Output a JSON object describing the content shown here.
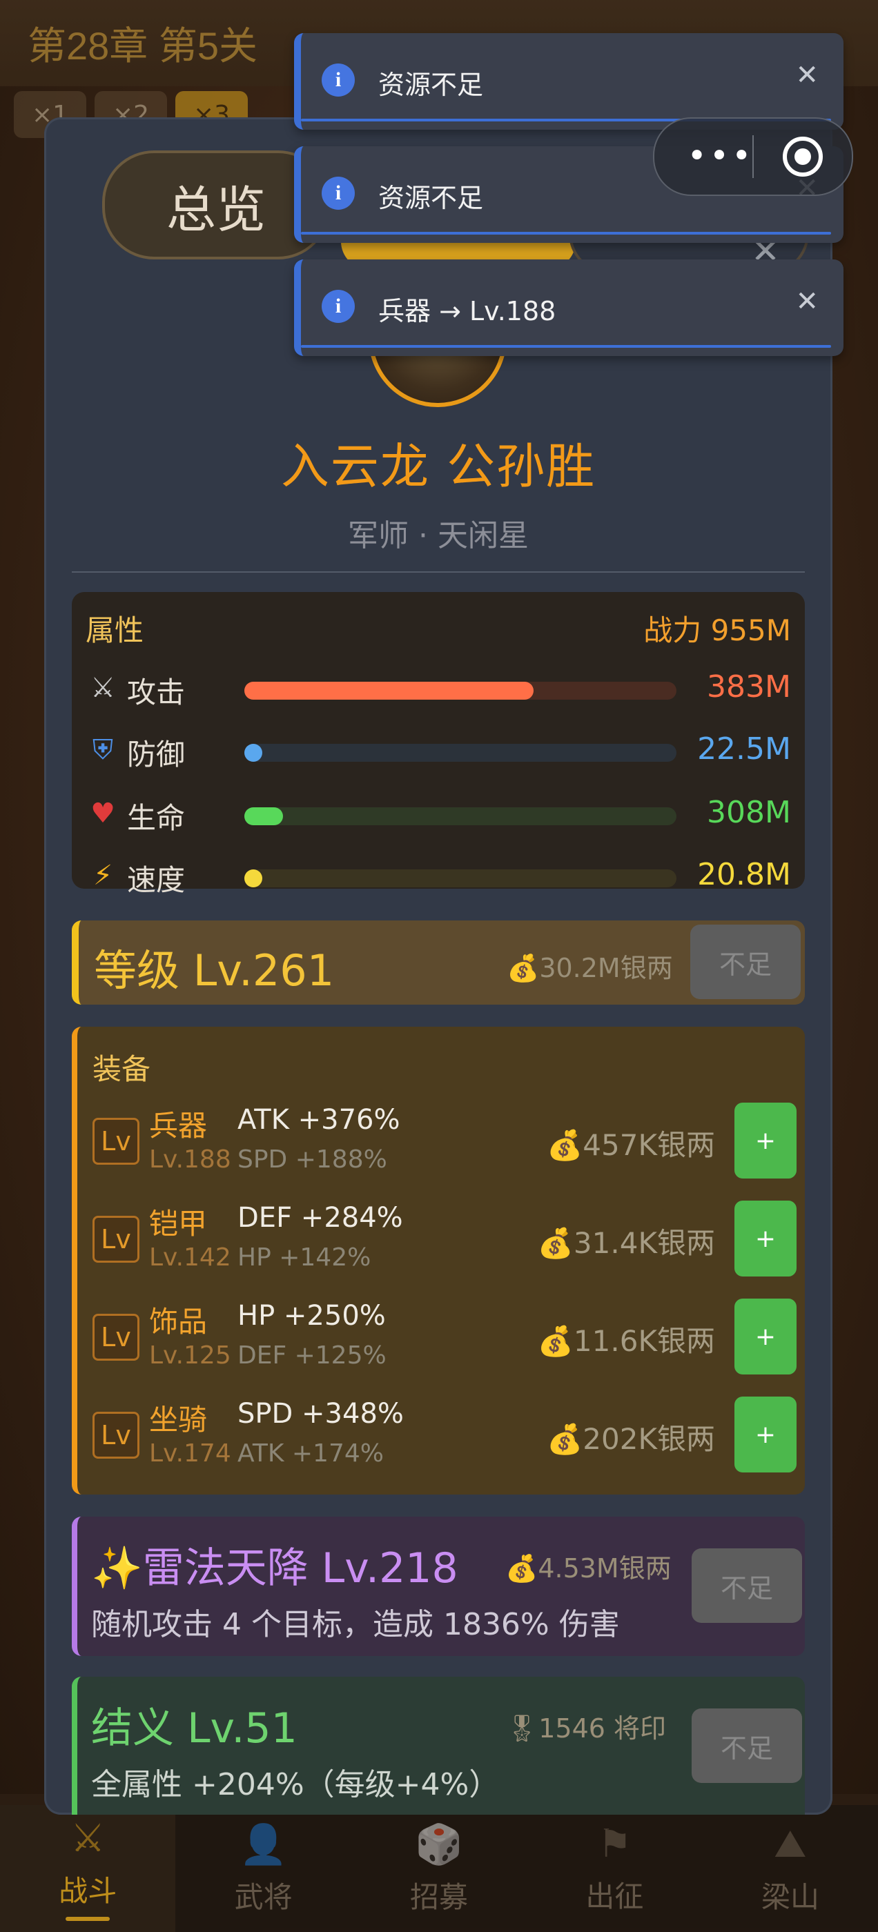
{
  "background": {
    "stage_title": "第28章 第5关",
    "speed_buttons": [
      "×1",
      "×2",
      "×3"
    ]
  },
  "bottom_nav": [
    {
      "label": "战斗",
      "icon": "⚔"
    },
    {
      "label": "武将",
      "icon": "👤"
    },
    {
      "label": "招募",
      "icon": "🎲"
    },
    {
      "label": "出征",
      "icon": "⚑"
    },
    {
      "label": "梁山",
      "icon": "⛰"
    }
  ],
  "panel": {
    "tab_overview": "总览",
    "hero_name": "入云龙 公孙胜",
    "hero_sub": "军师 · 天闲星"
  },
  "attributes": {
    "title": "属性",
    "power": "战力 955M",
    "rows": [
      {
        "icon": "⚔",
        "name": "攻击",
        "value": "383M",
        "fill": 0.67,
        "color": "#ff6f47",
        "track": "#4a2c22"
      },
      {
        "icon": "⛨",
        "name": "防御",
        "value": "22.5M",
        "fill": 0.04,
        "color": "#5aa7ee",
        "track": "#2b323a"
      },
      {
        "icon": "♥",
        "name": "生命",
        "value": "308M",
        "fill": 0.09,
        "color": "#58d85a",
        "track": "#2f3a26"
      },
      {
        "icon": "⚡",
        "name": "速度",
        "value": "20.8M",
        "fill": 0.04,
        "color": "#f5d93c",
        "track": "#3a3420"
      }
    ]
  },
  "level": {
    "text": "等级 Lv.261",
    "cost": "💰30.2M银两",
    "button": "不足"
  },
  "equipment": {
    "title": "装备",
    "badge": "Lv",
    "items": [
      {
        "name": "兵器",
        "lv": "Lv.188",
        "main": "ATK +376%",
        "sub": "SPD +188%",
        "cost": "💰457K银两",
        "button": "+"
      },
      {
        "name": "铠甲",
        "lv": "Lv.142",
        "main": "DEF +284%",
        "sub": "HP +142%",
        "cost": "💰31.4K银两",
        "button": "+"
      },
      {
        "name": "饰品",
        "lv": "Lv.125",
        "main": "HP +250%",
        "sub": "DEF +125%",
        "cost": "💰11.6K银两",
        "button": "+"
      },
      {
        "name": "坐骑",
        "lv": "Lv.174",
        "main": "SPD +348%",
        "sub": "ATK +174%",
        "cost": "💰202K银两",
        "button": "+"
      }
    ]
  },
  "skill": {
    "title": "✨雷法天降 Lv.218",
    "cost": "💰4.53M银两",
    "desc": "随机攻击 4 个目标，造成 1836% 伤害",
    "button": "不足"
  },
  "bond": {
    "title": "结义 Lv.51",
    "cost": "🎖1546 将印",
    "desc": "全属性 +204%（每级+4%）",
    "button": "不足"
  },
  "toasts": [
    {
      "text": "资源不足",
      "icon": "i",
      "close": "✕"
    },
    {
      "text": "资源不足",
      "icon": "i",
      "close": "✕"
    },
    {
      "text": "兵器 → Lv.188",
      "icon": "i",
      "close": "✕"
    }
  ],
  "capsule": {
    "dots": "•••"
  },
  "panel_close": "✕"
}
